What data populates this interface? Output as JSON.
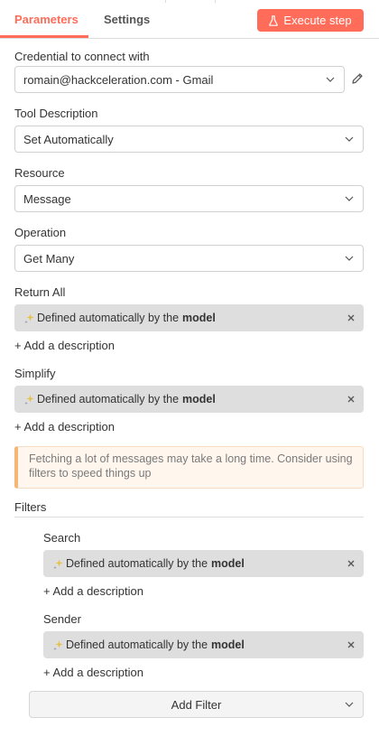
{
  "tabs": {
    "parameters": "Parameters",
    "settings": "Settings"
  },
  "toolbar": {
    "execute_label": "Execute step"
  },
  "credential": {
    "label": "Credential to connect with",
    "value": "romain@hackceleration.com - Gmail"
  },
  "tool_description": {
    "label": "Tool Description",
    "value": "Set Automatically"
  },
  "resource": {
    "label": "Resource",
    "value": "Message"
  },
  "operation": {
    "label": "Operation",
    "value": "Get Many"
  },
  "return_all": {
    "label": "Return All"
  },
  "simplify": {
    "label": "Simplify"
  },
  "auto_value": {
    "prefix": "Defined automatically by the",
    "emphasis": "model"
  },
  "add_description": "+ Add a description",
  "notice": {
    "text": "Fetching a lot of messages may take a long time. Consider using filters to speed things up"
  },
  "filters": {
    "label": "Filters",
    "search": {
      "label": "Search"
    },
    "sender": {
      "label": "Sender"
    },
    "add_filter_label": "Add Filter"
  },
  "colors": {
    "accent": "#ff6d5a",
    "notice_border": "#f5b574",
    "auto_bg": "#dedede"
  },
  "icons": {
    "execute": "flask-icon",
    "edit": "pencil-icon",
    "dropdown": "chevron-down-icon",
    "ai": "sparkle-icon",
    "clear": "close-icon"
  }
}
